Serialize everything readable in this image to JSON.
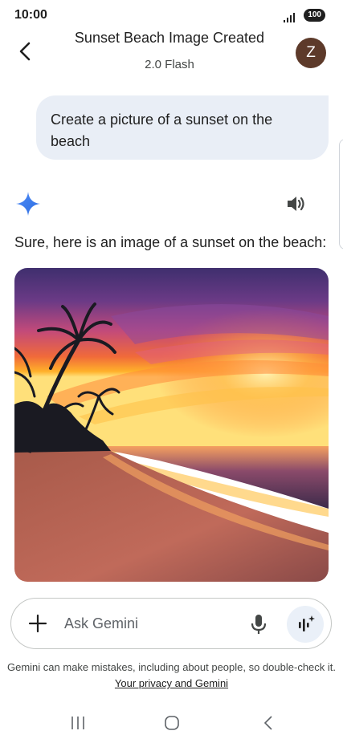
{
  "status_bar": {
    "time": "10:00",
    "battery": "100"
  },
  "header": {
    "title": "Sunset Beach Image Created",
    "subtitle": "2.0 Flash",
    "avatar_initial": "Z"
  },
  "conversation": {
    "user_prompt": "Create a picture of a sunset on the beach",
    "response_text": "Sure, here is an image of a sunset on the beach:"
  },
  "input": {
    "placeholder": "Ask Gemini"
  },
  "footer": {
    "disclaimer": "Gemini can make mistakes, including about people, so double-check it. ",
    "privacy_link": "Your privacy and Gemini"
  },
  "icons": [
    "back-arrow-icon",
    "sparkle-icon",
    "speaker-icon",
    "plus-icon",
    "mic-icon",
    "live-icon",
    "recents-icon",
    "home-icon",
    "nav-back-icon"
  ],
  "colors": {
    "accent": "#4285f4",
    "bubble": "#e9eef6",
    "avatar": "#5d3a2a"
  }
}
